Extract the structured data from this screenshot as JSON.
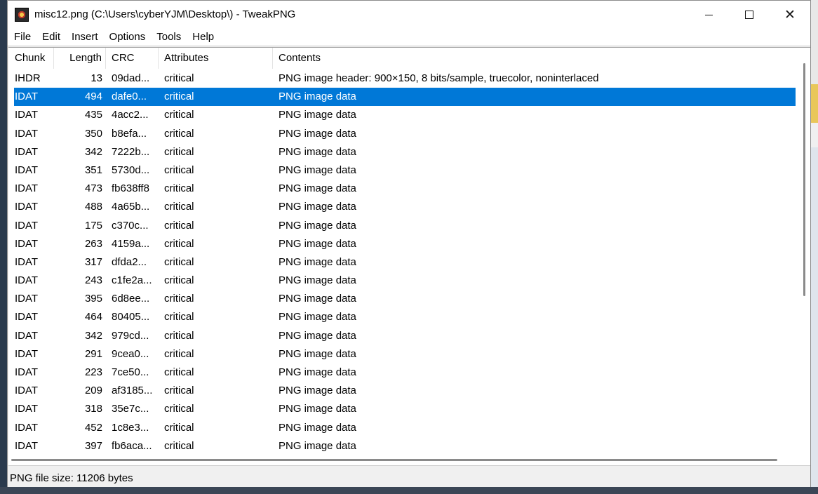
{
  "window": {
    "title": "misc12.png (C:\\Users\\cyberYJM\\Desktop\\) - TweakPNG",
    "minimize_label": "—",
    "maximize_label": "☐",
    "close_label": "✕"
  },
  "menu": [
    "File",
    "Edit",
    "Insert",
    "Options",
    "Tools",
    "Help"
  ],
  "columns": [
    "Chunk",
    "Length",
    "CRC",
    "Attributes",
    "Contents"
  ],
  "rows": [
    {
      "chunk": "IHDR",
      "length": "13",
      "crc": "09dad...",
      "attr": "critical",
      "contents": "PNG image header: 900×150, 8 bits/sample, truecolor, noninterlaced"
    },
    {
      "chunk": "IDAT",
      "length": "494",
      "crc": "dafe0...",
      "attr": "critical",
      "contents": "PNG image data"
    },
    {
      "chunk": "IDAT",
      "length": "435",
      "crc": "4acc2...",
      "attr": "critical",
      "contents": "PNG image data"
    },
    {
      "chunk": "IDAT",
      "length": "350",
      "crc": "b8efa...",
      "attr": "critical",
      "contents": "PNG image data"
    },
    {
      "chunk": "IDAT",
      "length": "342",
      "crc": "7222b...",
      "attr": "critical",
      "contents": "PNG image data"
    },
    {
      "chunk": "IDAT",
      "length": "351",
      "crc": "5730d...",
      "attr": "critical",
      "contents": "PNG image data"
    },
    {
      "chunk": "IDAT",
      "length": "473",
      "crc": "fb638ff8",
      "attr": "critical",
      "contents": "PNG image data"
    },
    {
      "chunk": "IDAT",
      "length": "488",
      "crc": "4a65b...",
      "attr": "critical",
      "contents": "PNG image data"
    },
    {
      "chunk": "IDAT",
      "length": "175",
      "crc": "c370c...",
      "attr": "critical",
      "contents": "PNG image data"
    },
    {
      "chunk": "IDAT",
      "length": "263",
      "crc": "4159a...",
      "attr": "critical",
      "contents": "PNG image data"
    },
    {
      "chunk": "IDAT",
      "length": "317",
      "crc": "dfda2...",
      "attr": "critical",
      "contents": "PNG image data"
    },
    {
      "chunk": "IDAT",
      "length": "243",
      "crc": "c1fe2a...",
      "attr": "critical",
      "contents": "PNG image data"
    },
    {
      "chunk": "IDAT",
      "length": "395",
      "crc": "6d8ee...",
      "attr": "critical",
      "contents": "PNG image data"
    },
    {
      "chunk": "IDAT",
      "length": "464",
      "crc": "80405...",
      "attr": "critical",
      "contents": "PNG image data"
    },
    {
      "chunk": "IDAT",
      "length": "342",
      "crc": "979cd...",
      "attr": "critical",
      "contents": "PNG image data"
    },
    {
      "chunk": "IDAT",
      "length": "291",
      "crc": "9cea0...",
      "attr": "critical",
      "contents": "PNG image data"
    },
    {
      "chunk": "IDAT",
      "length": "223",
      "crc": "7ce50...",
      "attr": "critical",
      "contents": "PNG image data"
    },
    {
      "chunk": "IDAT",
      "length": "209",
      "crc": "af3185...",
      "attr": "critical",
      "contents": "PNG image data"
    },
    {
      "chunk": "IDAT",
      "length": "318",
      "crc": "35e7c...",
      "attr": "critical",
      "contents": "PNG image data"
    },
    {
      "chunk": "IDAT",
      "length": "452",
      "crc": "1c8e3...",
      "attr": "critical",
      "contents": "PNG image data"
    },
    {
      "chunk": "IDAT",
      "length": "397",
      "crc": "fb6aca...",
      "attr": "critical",
      "contents": "PNG image data"
    }
  ],
  "selected_row": 1,
  "status": "PNG file size: 11206 bytes",
  "colors": {
    "selection": "#0078d7"
  }
}
